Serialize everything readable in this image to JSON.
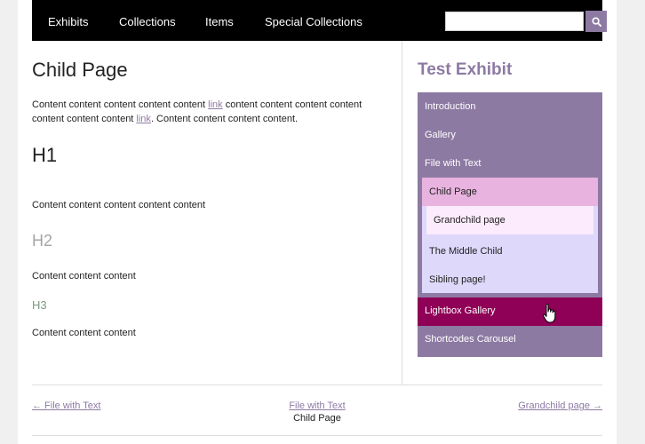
{
  "nav": {
    "items": [
      "Exhibits",
      "Collections",
      "Items",
      "Special Collections"
    ],
    "search_value": ""
  },
  "main": {
    "title": "Child Page",
    "para1": {
      "before": "Content content content content content ",
      "link1": "link",
      "middle": " content content content content content content content ",
      "link2": "link",
      "after": ". Content content content content."
    },
    "h1": "H1",
    "para2": "Content content content content content",
    "h2": "H2",
    "para3": "Content content content",
    "h3": "H3",
    "para4": "Content content content"
  },
  "sidebar": {
    "exhibit_title": "Test Exhibit",
    "items": [
      "Introduction",
      "Gallery",
      "File with Text",
      "Child Page",
      "Grandchild page",
      "The Middle Child",
      "Sibling page!",
      "Lightbox Gallery",
      "Shortcodes Carousel"
    ],
    "colors": {
      "accent": "#8d7aa3",
      "current_page": "#e9b3df",
      "subpages": "#ded8fb",
      "grandchild": "#fcebfc",
      "hover": "#8f0057"
    }
  },
  "pagination": {
    "prev": "← File with Text",
    "up_link": "File with Text",
    "up_current": "Child Page",
    "next": "Grandchild page →"
  },
  "icons": {
    "search": "search-icon",
    "cursor": "hand-pointer-icon"
  }
}
